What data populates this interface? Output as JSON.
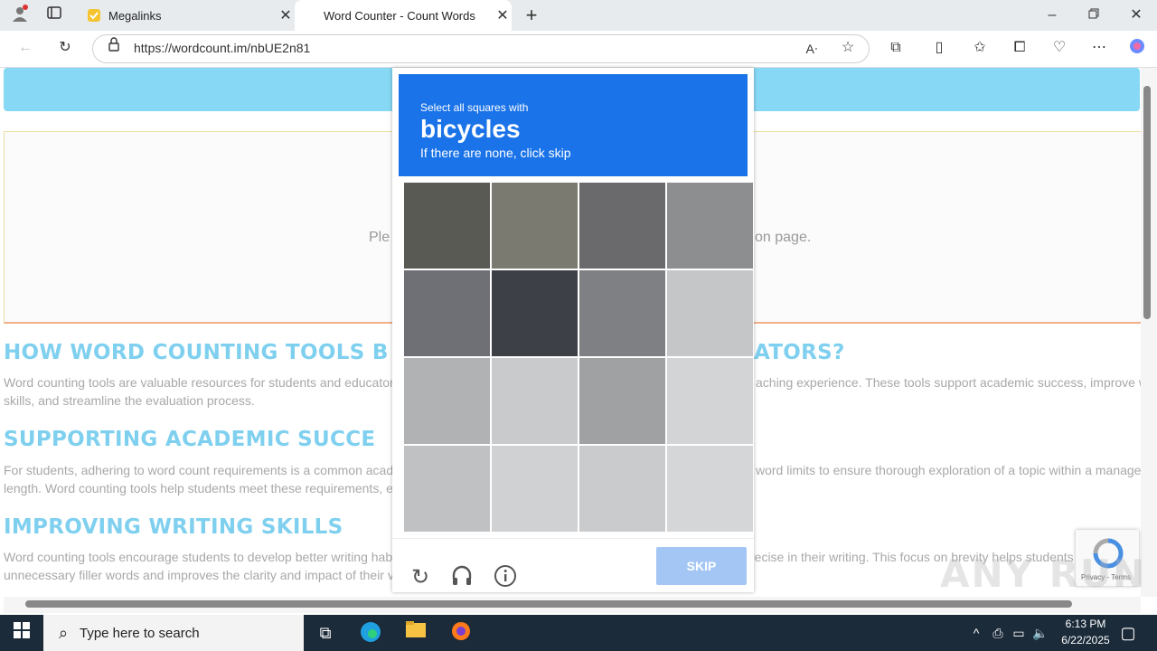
{
  "browser": {
    "tabs": [
      {
        "title": "Megalinks"
      },
      {
        "title": "Word Counter - Count Words"
      }
    ],
    "url": "https://wordcount.im/nbUE2n81"
  },
  "page": {
    "placeholder_left": "Ple",
    "placeholder_right": "on page.",
    "sections": [
      {
        "heading_left": "HOW WORD COUNTING TOOLS B",
        "heading_right": "ATORS?",
        "line1_left": "Word counting tools are valuable resources for students and educator",
        "line1_right": "aching experience. These tools support academic success, improve w",
        "line2": "skills, and streamline the evaluation process."
      },
      {
        "heading_left": "SUPPORTING ACADEMIC SUCCE",
        "line1_left": "For students, adhering to word count requirements is a common acad",
        "line1_right": "word limits to ensure thorough exploration of a topic within a manage",
        "line2": "length. Word counting tools help students meet these requirements, e"
      },
      {
        "heading_left": "IMPROVING WRITING SKILLS",
        "line1_left": "Word counting tools encourage students to develop better writing hab",
        "line1_right": "recise in their writing. This focus on brevity helps students",
        "line2": "unnecessary filler words and improves the clarity and impact of their v"
      }
    ]
  },
  "captcha": {
    "instruction": "Select all squares with",
    "target": "bicycles",
    "hint": "If there are none, click skip",
    "skip_label": "SKIP",
    "icons": [
      "reload-icon",
      "headphones-icon",
      "info-icon"
    ]
  },
  "recaptcha_badge": {
    "text": "Privacy - Terms"
  },
  "watermark": "ANY RUN",
  "taskbar": {
    "search_placeholder": "Type here to search",
    "time": "6:13 PM",
    "date": "6/22/2025"
  }
}
